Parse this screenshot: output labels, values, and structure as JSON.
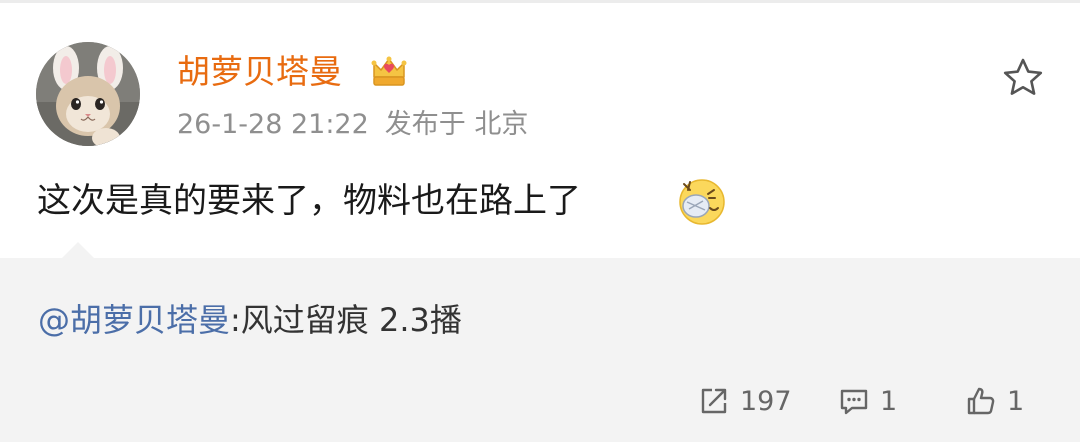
{
  "post": {
    "author": "胡萝贝塔曼",
    "timestamp": "26-1-28 21:22",
    "location": "发布于 北京",
    "text": "这次是真的要来了，物料也在路上了",
    "emoji_icon": "face-with-bandage-emoji"
  },
  "repost": {
    "mention": "@胡萝贝塔曼",
    "content": ":风过留痕 2.3播"
  },
  "actions": {
    "share_count": "197",
    "comment_count": "1",
    "like_count": "1"
  },
  "colors": {
    "username": "#e86b10",
    "meta": "#8f8f8f",
    "mention": "#4b6ea8",
    "panel_bg": "#f3f3f3"
  }
}
